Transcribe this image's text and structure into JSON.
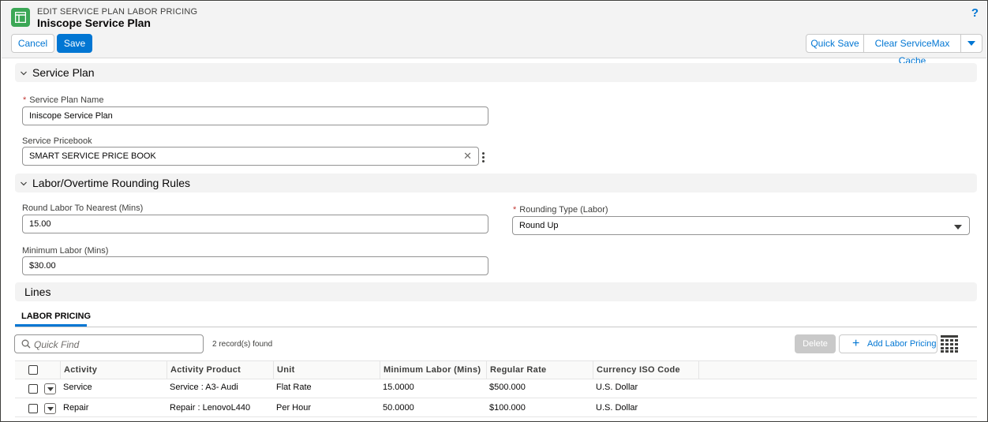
{
  "header": {
    "eyebrow": "EDIT SERVICE PLAN LABOR PRICING",
    "title": "Iniscope Service Plan",
    "help_label": "?",
    "cancel_label": "Cancel",
    "save_label": "Save",
    "quick_save_label": "Quick Save",
    "clear_cache_label": "Clear ServiceMax Cache"
  },
  "service_plan": {
    "title": "Service Plan",
    "name_label": "Service Plan Name",
    "name_value": "Iniscope Service Plan",
    "pricebook_label": "Service Pricebook",
    "pricebook_value": "SMART SERVICE PRICE BOOK",
    "clear_glyph": "✕"
  },
  "rounding": {
    "title": "Labor/Overtime Rounding Rules",
    "round_label": "Round Labor To Nearest (Mins)",
    "round_value": "15.00",
    "rounding_type_label": "Rounding Type (Labor)",
    "rounding_type_value": "Round Up",
    "min_label": "Minimum Labor (Mins)",
    "min_value": "$30.00"
  },
  "lines": {
    "title": "Lines",
    "tab_label": "LABOR PRICING",
    "search_placeholder": "Quick Find",
    "records_text": "2 record(s) found",
    "delete_label": "Delete",
    "add_label": "Add Labor Pricing",
    "add_glyph": "+",
    "columns": [
      "Activity",
      "Activity Product",
      "Unit",
      "Minimum Labor (Mins)",
      "Regular Rate",
      "Currency ISO Code"
    ],
    "rows": [
      [
        "Service",
        "Service : A3- Audi",
        "Flat Rate",
        "15.0000",
        "$500.000",
        "U.S. Dollar"
      ],
      [
        "Repair",
        "Repair : LenovoL440",
        "Per Hour",
        "50.0000",
        "$100.000",
        "U.S. Dollar"
      ]
    ]
  },
  "colors": {
    "brand_blue": "#0176d3",
    "app_icon_green": "#3ba755",
    "required_red": "#c23934"
  },
  "icons": [
    "app-icon",
    "help-icon",
    "chevron-down-icon",
    "clear-icon",
    "kebab-icon",
    "search-icon",
    "plus-icon",
    "columns-grid-icon",
    "row-menu-icon"
  ]
}
